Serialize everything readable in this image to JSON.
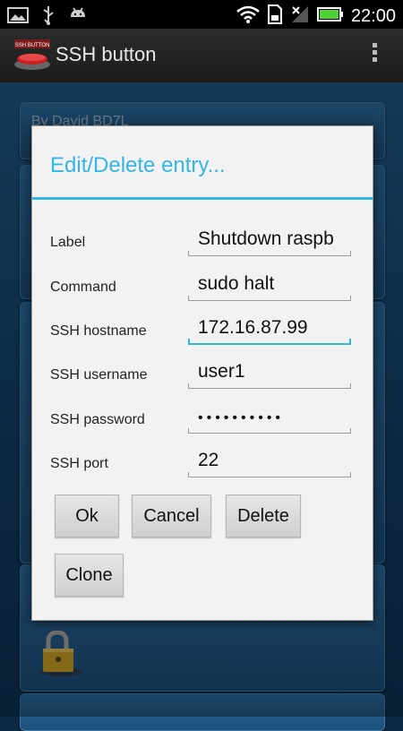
{
  "status_bar": {
    "time": "22:00",
    "icons": [
      "gallery-icon",
      "usb-icon",
      "android-icon",
      "wifi-icon",
      "sd-card-icon",
      "signal-icon",
      "battery-icon"
    ]
  },
  "action_bar": {
    "title": "SSH button",
    "app_icon_text": "SSH BUTTON",
    "overflow_icon": "overflow-menu-icon"
  },
  "background": {
    "first_card_text": "By David BD7L"
  },
  "dialog": {
    "title": "Edit/Delete entry...",
    "fields": [
      {
        "label": "Label",
        "value": "Shutdown raspb"
      },
      {
        "label": "Command",
        "value": "sudo halt"
      },
      {
        "label": "SSH hostname",
        "value": "172.16.87.99"
      },
      {
        "label": "SSH username",
        "value": "user1"
      },
      {
        "label": "SSH password",
        "value": "••••••••••"
      },
      {
        "label": "SSH port",
        "value": "22"
      }
    ],
    "buttons": {
      "ok": "Ok",
      "cancel": "Cancel",
      "delete": "Delete",
      "clone": "Clone"
    }
  },
  "colors": {
    "accent": "#33b5e5",
    "dialog_bg": "#f2f2f2",
    "battery": "#4cd137"
  }
}
